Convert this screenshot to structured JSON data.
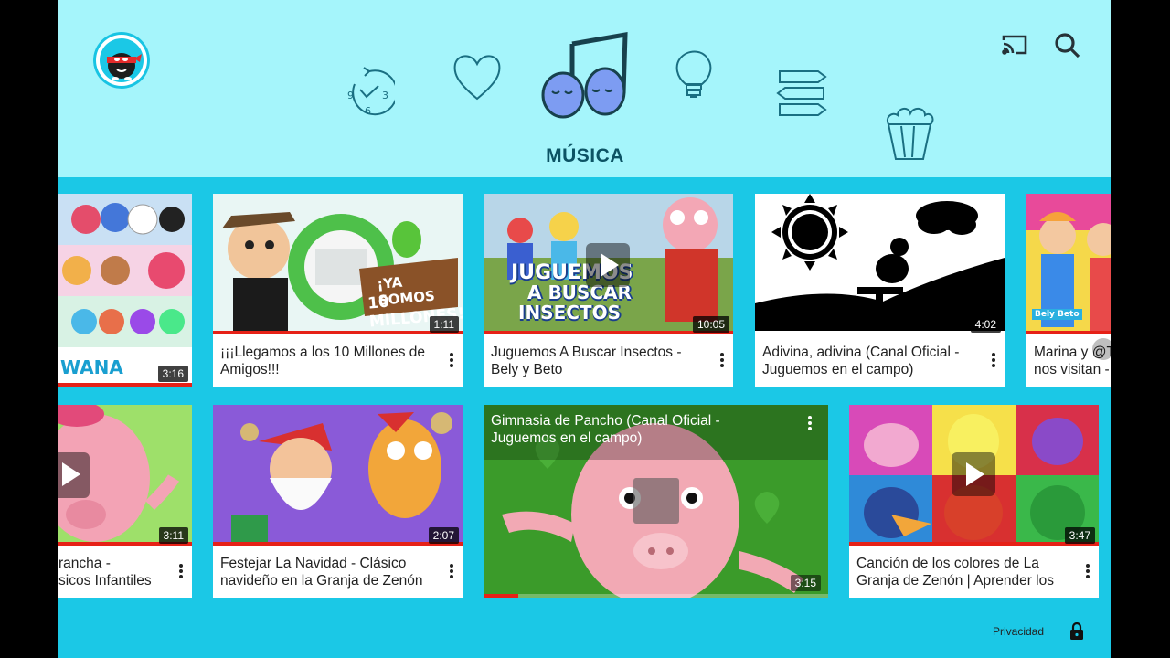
{
  "header": {
    "section_title": "MÚSICA",
    "categories": [
      {
        "icon": "clock-icon"
      },
      {
        "icon": "heart-icon"
      },
      {
        "icon": "music-notes-icon",
        "selected": true
      },
      {
        "icon": "lightbulb-icon"
      },
      {
        "icon": "signpost-icon"
      },
      {
        "icon": "popcorn-icon"
      }
    ],
    "cast_icon": "cast-icon",
    "search_icon": "search-icon"
  },
  "colors": {
    "header_bg": "#a5f5fb",
    "content_bg": "#1bc8e6",
    "title_text": "#0c5364",
    "accent_red": "#e62117"
  },
  "row1": [
    {
      "title": "",
      "thumb_text": "WANA",
      "duration": "3:16"
    },
    {
      "title": "¡¡¡Llegamos a los 10 Millones de Amigos!!!",
      "thumb_text_1": "¡YA SOMOS",
      "thumb_text_2": "10 MILLONES!",
      "duration": "1:11"
    },
    {
      "title": "Juguemos A Buscar Insectos - Bely y Beto",
      "thumb_text_1": "JUGUEMOS",
      "thumb_text_2": "A BUSCAR",
      "thumb_text_3": "INSECTOS",
      "duration": "10:05"
    },
    {
      "title": "Adivina, adivina (Canal Oficial - Juguemos en el campo)",
      "duration": "4:02"
    },
    {
      "title": "Marina y @T nos visitan -",
      "duration": ""
    }
  ],
  "row2": [
    {
      "title": "Pancha - Clásicos Infantiles",
      "title_visible": "rancha -\nsicos Infantiles",
      "duration": "3:11"
    },
    {
      "title": "Festejar La Navidad - Clásico navideño en la Granja de Zenón",
      "duration": "2:07"
    },
    {
      "title": "Gimnasia de Pancho (Canal Oficial - Juguemos en el campo)",
      "duration": "3:15",
      "playing": true
    },
    {
      "title": "Canción de los colores de La Granja de Zenón | Aprender los",
      "duration": "3:47"
    }
  ],
  "footer": {
    "privacy_label": "Privacidad",
    "lock_icon": "lock-icon"
  }
}
